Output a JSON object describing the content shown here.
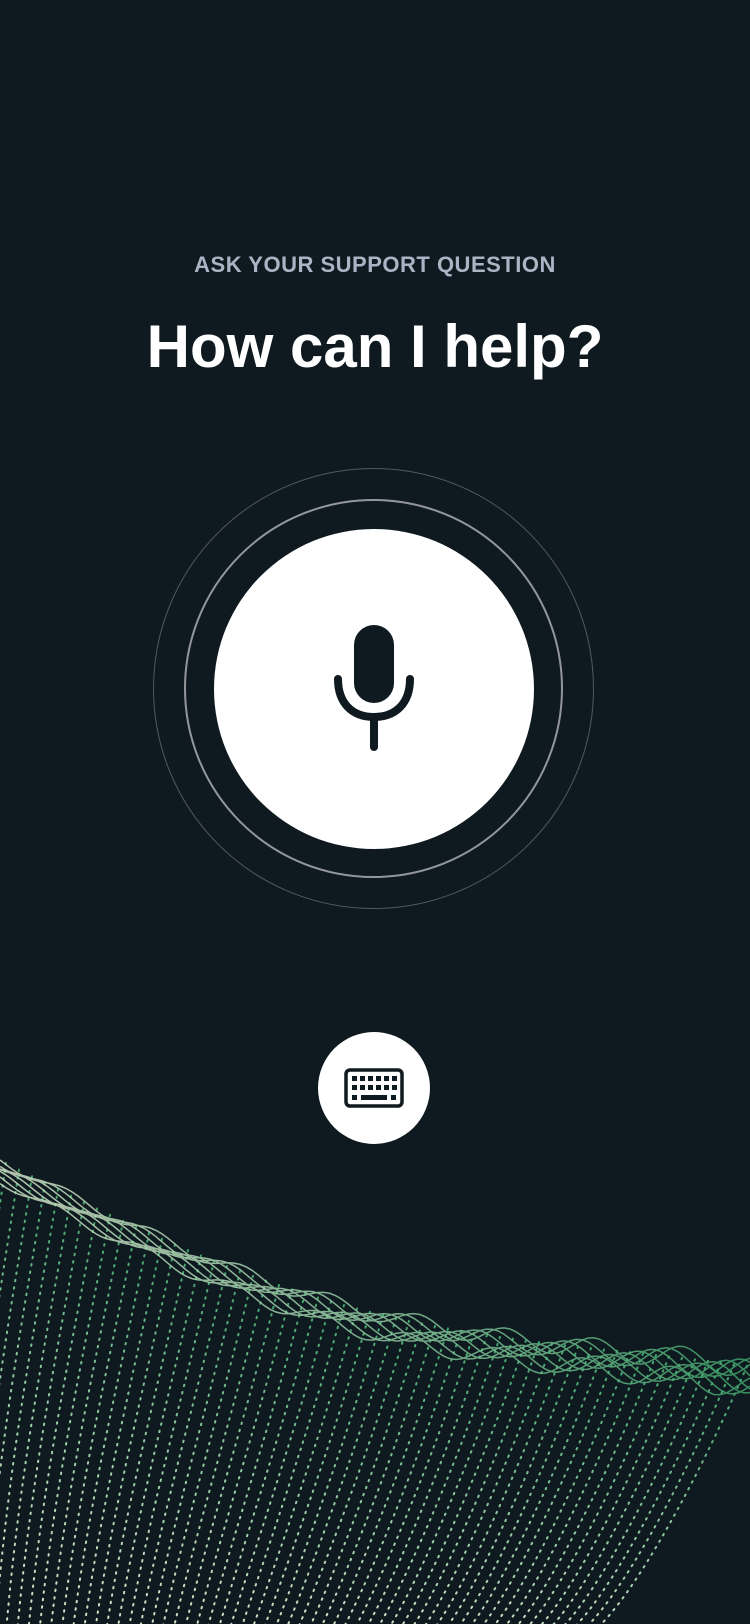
{
  "header": {
    "subtitle": "ASK YOUR SUPPORT QUESTION",
    "title": "How can I help?"
  },
  "voice": {
    "icon": "microphone-icon"
  },
  "keyboard": {
    "icon": "keyboard-icon"
  },
  "colors": {
    "background": "#0f1a20",
    "subtitle": "#a9b4c4",
    "title": "#ffffff",
    "button": "#ffffff",
    "icon": "#0f1a20",
    "wave_light": "#cfe3c7",
    "wave_green": "#3fa36b"
  }
}
